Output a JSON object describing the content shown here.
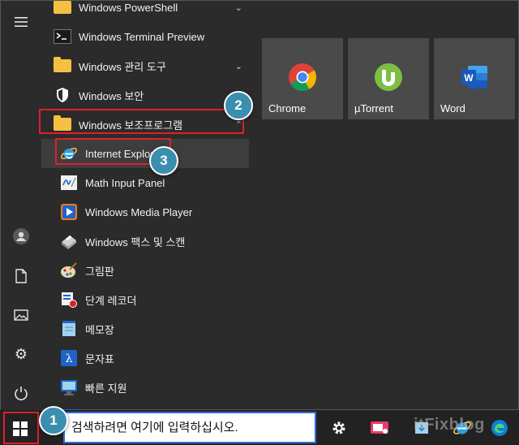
{
  "left_rail": {
    "items": [
      {
        "icon": "hamburger-menu-icon",
        "glyph": "☰"
      },
      {
        "icon": "user-avatar-icon",
        "glyph": ""
      },
      {
        "icon": "document-icon",
        "glyph": ""
      },
      {
        "icon": "pictures-icon",
        "glyph": ""
      },
      {
        "icon": "settings-gear-icon",
        "glyph": "⚙"
      },
      {
        "icon": "power-icon",
        "glyph": "⏻"
      }
    ]
  },
  "app_list": [
    {
      "label": "Windows PowerShell",
      "icon": "folder-icon",
      "expandable": true
    },
    {
      "label": "Windows Terminal Preview",
      "icon": "terminal-icon",
      "expandable": false
    },
    {
      "label": "Windows 관리 도구",
      "icon": "folder-icon",
      "expandable": true
    },
    {
      "label": "Windows 보안",
      "icon": "shield-icon",
      "expandable": false
    },
    {
      "label": "Windows 보조프로그램",
      "icon": "folder-icon",
      "expandable": true
    },
    {
      "label": "Internet Explorer",
      "icon": "internet-explorer-icon",
      "expandable": false
    },
    {
      "label": "Math Input Panel",
      "icon": "math-input-icon",
      "expandable": false
    },
    {
      "label": "Windows Media Player",
      "icon": "media-player-icon",
      "expandable": false
    },
    {
      "label": "Windows 팩스 및 스캔",
      "icon": "fax-scan-icon",
      "expandable": false
    },
    {
      "label": "그림판",
      "icon": "paint-icon",
      "expandable": false
    },
    {
      "label": "단계 레코더",
      "icon": "steps-recorder-icon",
      "expandable": false
    },
    {
      "label": "메모장",
      "icon": "notepad-icon",
      "expandable": false
    },
    {
      "label": "문자표",
      "icon": "character-map-icon",
      "expandable": false
    },
    {
      "label": "빠른 지원",
      "icon": "quick-assist-icon",
      "expandable": false
    }
  ],
  "tiles": [
    {
      "label": "Chrome",
      "icon": "chrome-icon"
    },
    {
      "label": "µTorrent",
      "icon": "utorrent-icon"
    },
    {
      "label": "Word",
      "icon": "word-icon"
    }
  ],
  "taskbar": {
    "search_text": "검색하려면 여기에 입력하십시오."
  },
  "annotations": {
    "badge1": "1",
    "badge2": "2",
    "badge3": "3",
    "color_red": "#e0202a",
    "color_badge": "#3a8fb0"
  },
  "watermark": "itFixblog"
}
